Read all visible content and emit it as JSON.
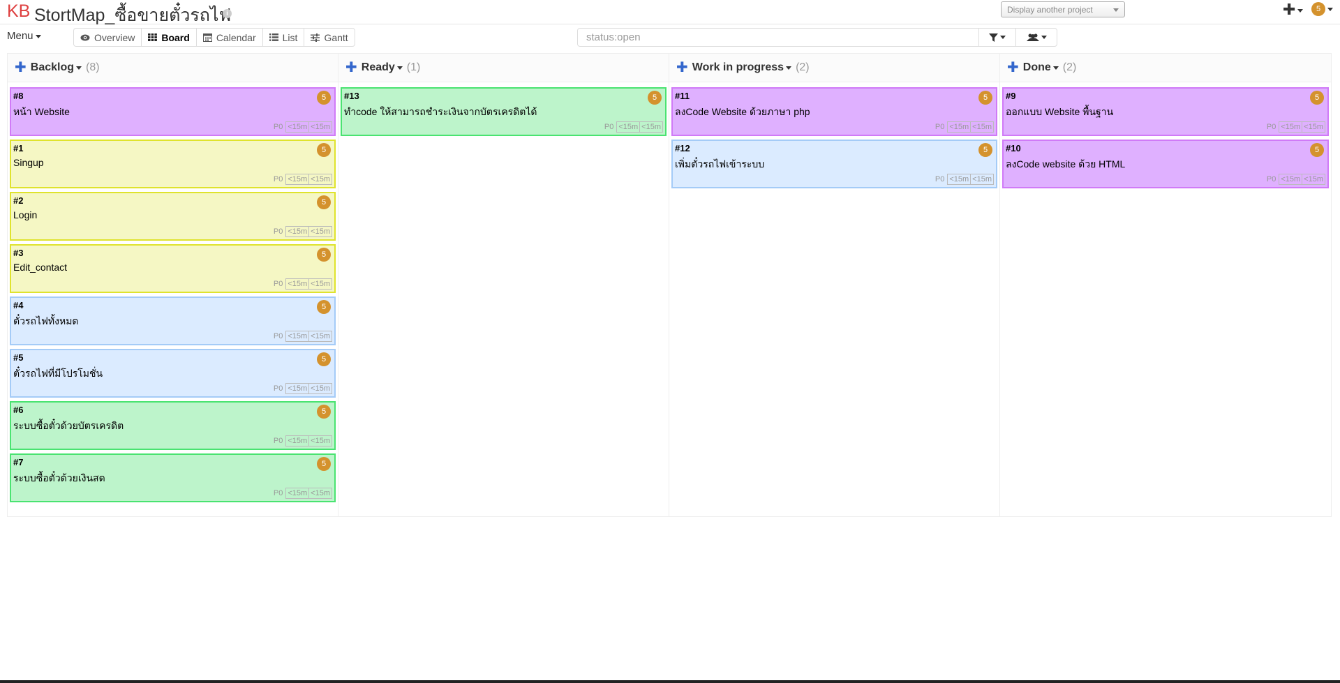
{
  "header": {
    "logo": "KB",
    "title": "StortMap_ซื้อขายตั๋วรถไฟ",
    "info_icon": "i",
    "project_select": "Display another project",
    "user_avatar": "5"
  },
  "toolbar": {
    "menu_label": "Menu",
    "views": [
      {
        "label": "Overview",
        "icon": "eye-icon"
      },
      {
        "label": "Board",
        "icon": "board-icon"
      },
      {
        "label": "Calendar",
        "icon": "calendar-icon"
      },
      {
        "label": "List",
        "icon": "list-icon"
      },
      {
        "label": "Gantt",
        "icon": "sliders-icon"
      }
    ],
    "active_view": "Board",
    "search_value": "status:open"
  },
  "columns": [
    {
      "title": "Backlog",
      "count": "(8)"
    },
    {
      "title": "Ready",
      "count": "(1)"
    },
    {
      "title": "Work in progress",
      "count": "(2)"
    },
    {
      "title": "Done",
      "count": "(2)"
    }
  ],
  "colors": {
    "purple": "#dfb0ff",
    "yellow": "#f5f7c4",
    "blue": "#dbebff",
    "green": "#bdf4cb",
    "badge": "#d4922d",
    "accent": "#3366cc"
  },
  "cards": [
    [
      {
        "id": "#8",
        "title": "หน้า Website",
        "color": "purple",
        "badge": "5",
        "priority": "P0",
        "t1": "<15m",
        "t2": "<15m"
      },
      {
        "id": "#1",
        "title": "Singup",
        "color": "yellow",
        "badge": "5",
        "priority": "P0",
        "t1": "<15m",
        "t2": "<15m"
      },
      {
        "id": "#2",
        "title": "Login",
        "color": "yellow",
        "badge": "5",
        "priority": "P0",
        "t1": "<15m",
        "t2": "<15m"
      },
      {
        "id": "#3",
        "title": "Edit_contact",
        "color": "yellow",
        "badge": "5",
        "priority": "P0",
        "t1": "<15m",
        "t2": "<15m"
      },
      {
        "id": "#4",
        "title": "ตั๋วรถไฟทั้งหมด",
        "color": "blue",
        "badge": "5",
        "priority": "P0",
        "t1": "<15m",
        "t2": "<15m"
      },
      {
        "id": "#5",
        "title": "ตั๋วรถไฟที่มีโปรโมชั่น",
        "color": "blue",
        "badge": "5",
        "priority": "P0",
        "t1": "<15m",
        "t2": "<15m"
      },
      {
        "id": "#6",
        "title": "ระบบซื้อตั๋วด้วยบัตรเครดิต",
        "color": "green",
        "badge": "5",
        "priority": "P0",
        "t1": "<15m",
        "t2": "<15m"
      },
      {
        "id": "#7",
        "title": "ระบบซื้อตั๋วด้วยเงินสด",
        "color": "green",
        "badge": "5",
        "priority": "P0",
        "t1": "<15m",
        "t2": "<15m"
      }
    ],
    [
      {
        "id": "#13",
        "title": "ทำcode ให้สามารถชำระเงินจากบัตรเครดิตได้",
        "color": "green",
        "badge": "5",
        "priority": "P0",
        "t1": "<15m",
        "t2": "<15m"
      }
    ],
    [
      {
        "id": "#11",
        "title": "ลงCode Website ด้วยภาษา php",
        "color": "purple",
        "badge": "5",
        "priority": "P0",
        "t1": "<15m",
        "t2": "<15m"
      },
      {
        "id": "#12",
        "title": "เพิ่มตั๋วรถไฟเข้าระบบ",
        "color": "blue",
        "badge": "5",
        "priority": "P0",
        "t1": "<15m",
        "t2": "<15m"
      }
    ],
    [
      {
        "id": "#9",
        "title": "ออกแบบ Website พื้นฐาน",
        "color": "purple",
        "badge": "5",
        "priority": "P0",
        "t1": "<15m",
        "t2": "<15m"
      },
      {
        "id": "#10",
        "title": "ลงCode website ด้วย HTML",
        "color": "purple",
        "badge": "5",
        "priority": "P0",
        "t1": "<15m",
        "t2": "<15m"
      }
    ]
  ]
}
